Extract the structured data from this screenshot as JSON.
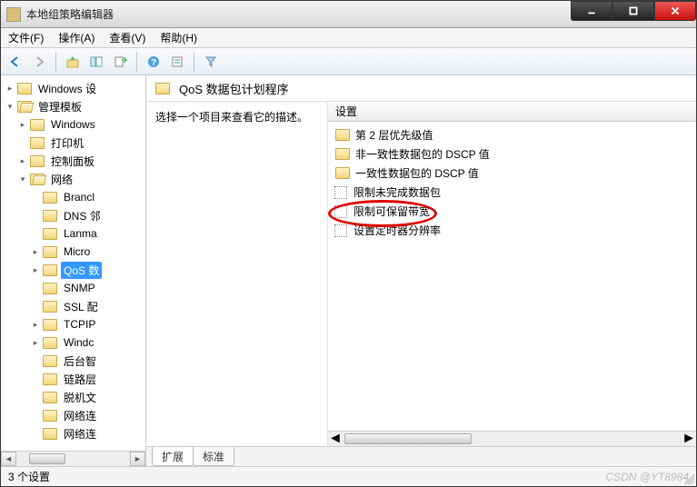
{
  "window": {
    "title": "本地组策略编辑器"
  },
  "menu": {
    "file": "文件(F)",
    "action": "操作(A)",
    "view": "查看(V)",
    "help": "帮助(H)"
  },
  "toolbar_icons": {
    "back": "back-icon",
    "forward": "forward-icon",
    "up": "up-icon",
    "show_hide": "show-hide-tree-icon",
    "export": "export-list-icon",
    "help": "help-icon",
    "properties": "properties-icon",
    "filter": "filter-icon"
  },
  "tree": {
    "items": [
      {
        "label": "Windows 设",
        "expand": "closed"
      },
      {
        "label": "管理模板",
        "expand": "open",
        "open_folder": true,
        "children": [
          {
            "label": "Windows",
            "expand": "closed"
          },
          {
            "label": "打印机",
            "expand": "none"
          },
          {
            "label": "控制面板",
            "expand": "closed"
          },
          {
            "label": "网络",
            "expand": "open",
            "open_folder": true,
            "children": [
              {
                "label": "Brancl",
                "expand": "none"
              },
              {
                "label": "DNS 邻",
                "expand": "none"
              },
              {
                "label": "Lanma",
                "expand": "none"
              },
              {
                "label": "Micro",
                "expand": "closed"
              },
              {
                "label": "QoS 数",
                "expand": "closed",
                "selected": true
              },
              {
                "label": "SNMP",
                "expand": "none"
              },
              {
                "label": "SSL 配",
                "expand": "none"
              },
              {
                "label": "TCPIP",
                "expand": "closed"
              },
              {
                "label": "Windc",
                "expand": "closed"
              },
              {
                "label": "后台智",
                "expand": "none"
              },
              {
                "label": "链路层",
                "expand": "none"
              },
              {
                "label": "脱机文",
                "expand": "none"
              },
              {
                "label": "网络连",
                "expand": "none"
              },
              {
                "label": "网络连",
                "expand": "none"
              }
            ]
          }
        ]
      }
    ]
  },
  "content": {
    "header_title": "QoS 数据包计划程序",
    "desc_prompt": "选择一个项目来查看它的描述。",
    "list_header": "设置",
    "items": [
      {
        "type": "folder",
        "label": "第 2 层优先级值"
      },
      {
        "type": "folder",
        "label": "非一致性数据包的 DSCP 值"
      },
      {
        "type": "folder",
        "label": "一致性数据包的 DSCP 值"
      },
      {
        "type": "setting",
        "label": "限制未完成数据包"
      },
      {
        "type": "setting",
        "label": "限制可保留带宽",
        "circled": true
      },
      {
        "type": "setting",
        "label": "设置定时器分辨率"
      }
    ]
  },
  "tabs": {
    "extended": "扩展",
    "standard": "标准",
    "active": "extended"
  },
  "status": {
    "text": "3 个设置",
    "watermark": "CSDN @YT8984"
  }
}
